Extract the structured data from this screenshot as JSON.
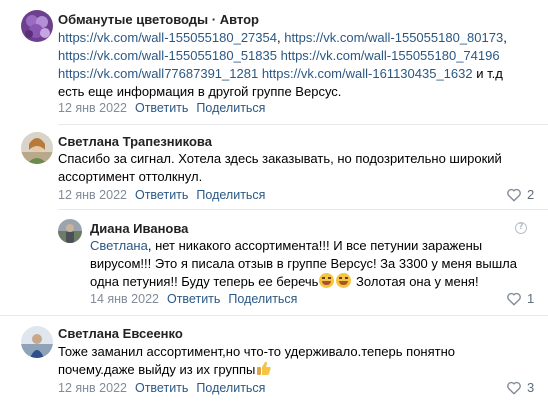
{
  "comments": [
    {
      "author": "Обманутые цветоводы · Автор",
      "links": [
        "https://vk.com/wall-155055180_27354",
        "https://vk.com/wall-155055180_80173",
        "https://vk.com/wall-155055180_51835",
        "https://vk.com/wall-155055180_74196",
        "https://vk.com/wall77687391_1281",
        "https://vk.com/wall-161130435_1632"
      ],
      "text_tail": " и т.д",
      "text_line2": "есть еще информация в другой группе Версус.",
      "date": "12 янв 2022",
      "reply": "Ответить",
      "share": "Поделиться"
    },
    {
      "author": "Светлана Трапезникова",
      "text": "Спасибо за сигнал. Хотела здесь заказывать, но подозрительно широкий ассортимент оттолкнул.",
      "date": "12 янв 2022",
      "reply": "Ответить",
      "share": "Поделиться",
      "likes": "2"
    },
    {
      "author": "Диана Иванова",
      "mention": "Светлана",
      "text": ", нет никакого ассортимента!!! И все петунии заражены вирусом!!! Это я писала отзыв в группе Версус! За 3300 у меня вышла одна петуния!! Буду теперь ее беречь",
      "text_end": " Золотая она у меня!",
      "date": "14 янв 2022",
      "reply": "Ответить",
      "share": "Поделиться",
      "likes": "1",
      "info": "?"
    },
    {
      "author": "Светлана Евсеенко",
      "text": "Тоже заманил ассортимент,но что-то удерживало.теперь понятно почему.даже выйду из их группы",
      "date": "12 янв 2022",
      "reply": "Ответить",
      "share": "Поделиться",
      "likes": "3"
    }
  ],
  "icons": {
    "like": "heart-icon",
    "info": "question-icon",
    "emoji": "rofl-emoji",
    "thumb": "thumbs-up-emoji"
  },
  "colors": {
    "link": "#2a5885",
    "meta": "#818c99",
    "divider": "#e7e8ec"
  }
}
